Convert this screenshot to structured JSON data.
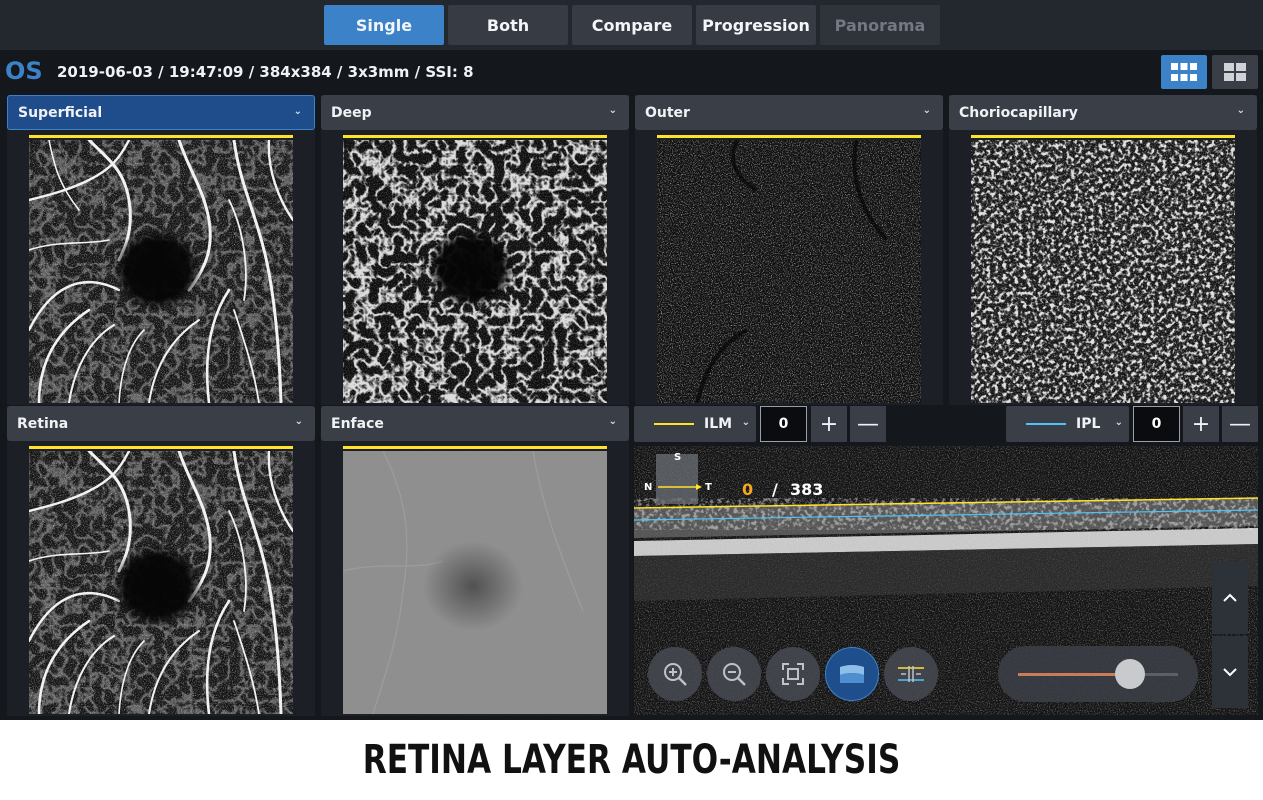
{
  "mode_tabs": [
    {
      "label": "Single",
      "state": "active"
    },
    {
      "label": "Both",
      "state": "normal"
    },
    {
      "label": "Compare",
      "state": "normal"
    },
    {
      "label": "Progression",
      "state": "normal"
    },
    {
      "label": "Panorama",
      "state": "disabled"
    }
  ],
  "info": {
    "eye": "OS",
    "meta": "2019-06-03 / 19:47:09 / 384x384 / 3x3mm / SSI: 8"
  },
  "layout_buttons": [
    {
      "icon": "grid-6-icon",
      "state": "active"
    },
    {
      "icon": "grid-4-icon",
      "state": "normal"
    }
  ],
  "panels": [
    {
      "title": "Superficial",
      "active": true
    },
    {
      "title": "Deep",
      "active": false
    },
    {
      "title": "Outer",
      "active": false
    },
    {
      "title": "Choriocapillary",
      "active": false
    },
    {
      "title": "Retina",
      "active": false
    },
    {
      "title": "Enface",
      "active": false
    }
  ],
  "segmentation": {
    "upper": {
      "layer": "ILM",
      "offset": "0",
      "line_color": "#ffe22a"
    },
    "lower": {
      "layer": "IPL",
      "offset": "0",
      "line_color": "#4fc3f7"
    }
  },
  "bscan": {
    "orientation": {
      "top": "S",
      "left": "N",
      "right": "T"
    },
    "current_slice": "0",
    "separator": "/",
    "total_slices": "383",
    "slider_level": 0.7
  },
  "colors": {
    "accent": "#3b82c8",
    "segmentation_yellow": "#ffe22a",
    "slice_orange": "#f5a623"
  },
  "caption": "RETINA LAYER AUTO-ANALYSIS"
}
